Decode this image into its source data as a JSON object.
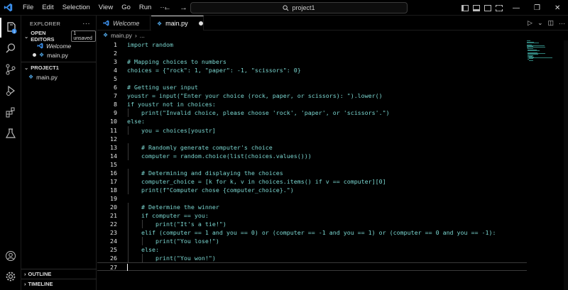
{
  "titlebar": {
    "menu": [
      "File",
      "Edit",
      "Selection",
      "View",
      "Go",
      "Run",
      "···"
    ],
    "search_text": "project1"
  },
  "sidebar": {
    "header": "EXPLORER",
    "open_editors_label": "OPEN EDITORS",
    "unsaved_badge": "1 unsaved",
    "open_editors": [
      "Welcome",
      "main.py"
    ],
    "project_label": "PROJECT1",
    "files": [
      "main.py"
    ],
    "outline_label": "OUTLINE",
    "timeline_label": "TIMELINE"
  },
  "tabs": [
    {
      "label": "Welcome"
    },
    {
      "label": "main.py"
    }
  ],
  "breadcrumb": {
    "file": "main.py",
    "rest": "..."
  },
  "editor": {
    "lines": [
      "import random",
      "",
      "# Mapping choices to numbers",
      "choices = {\"rock\": 1, \"paper\": -1, \"scissors\": 0}",
      "",
      "# Getting user input",
      "youstr = input(\"Enter your choice (rock, paper, or scissors): \").lower()",
      "if youstr not in choices:",
      "    print(\"Invalid choice, please choose 'rock', 'paper', or 'scissors'.\")",
      "else:",
      "    you = choices[youstr]",
      "",
      "    # Randomly generate computer's choice",
      "    computer = random.choice(list(choices.values()))",
      "",
      "    # Determining and displaying the choices",
      "    computer_choice = [k for k, v in choices.items() if v == computer][0]",
      "    print(f\"Computer chose {computer_choice}.\")",
      "",
      "    # Determine the winner",
      "    if computer == you:",
      "        print(\"It's a tie!\")",
      "    elif (computer == 1 and you == 0) or (computer == -1 and you == 1) or (computer == 0 and you == -1):",
      "        print(\"You lose!\")",
      "    else:",
      "        print(\"You won!\")",
      ""
    ]
  },
  "colors": {
    "code": "#7ad6d0",
    "line_numbers": "#e6e6e6",
    "accent_blue": "#3b8eea",
    "background": "#000000"
  },
  "icons": [
    "vscode-logo-icon",
    "files-icon",
    "search-icon",
    "source-control-icon",
    "run-debug-icon",
    "extensions-icon",
    "testing-icon",
    "account-icon",
    "settings-gear-icon",
    "python-file-icon"
  ]
}
